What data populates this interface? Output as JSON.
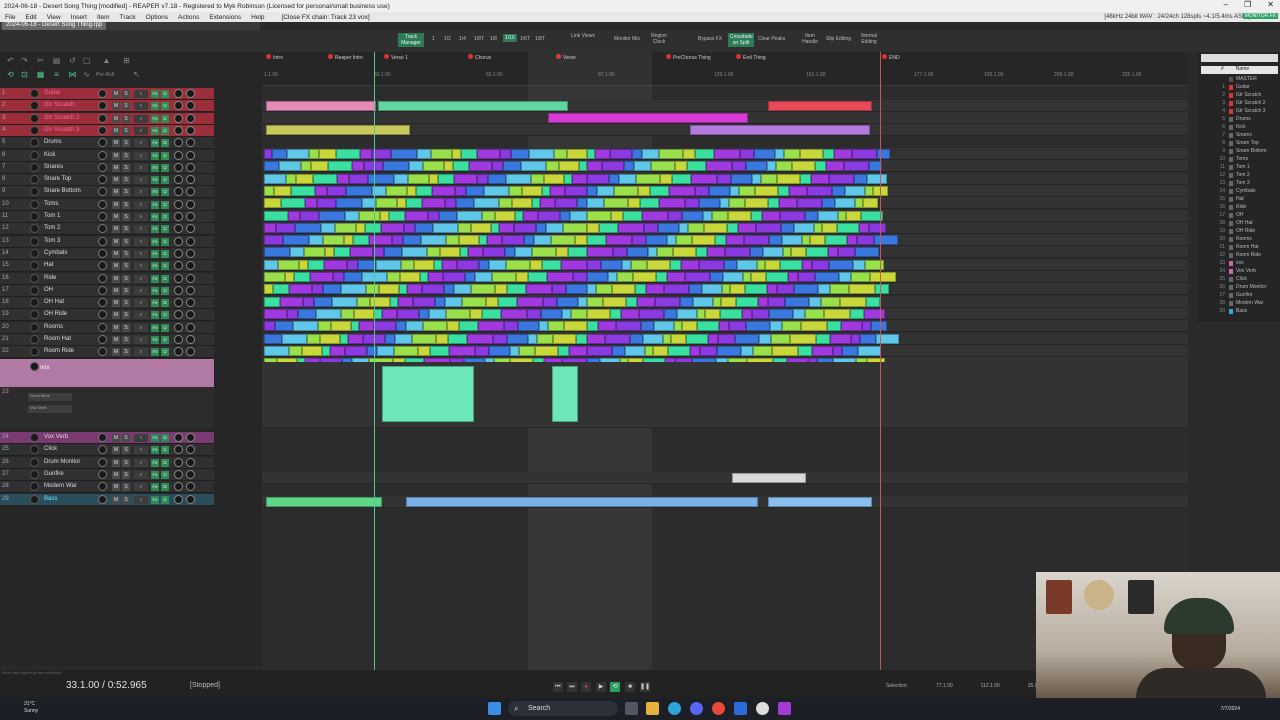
{
  "window": {
    "title": "2024-06-18 - Desert Song Thing [modified] - REAPER v7.18 - Registered to Myk Robinson (Licensed for personal/small business use)",
    "controls": [
      "–",
      "❐",
      "✕"
    ]
  },
  "menu": {
    "items": [
      "File",
      "Edit",
      "View",
      "Insert",
      "Item",
      "Track",
      "Options",
      "Actions",
      "Extensions",
      "Help"
    ],
    "fx_chain_label": "[Close FX chain: Track 23 vox]",
    "status_right": "[48kHz 24bit WAV : 24/24ch 128spls ~4.1/5.4ms ASIO]",
    "mode_indicator": "MONITOR FX"
  },
  "project_tab": "2024-06-18 - Desert Song Thing.rpp",
  "toolbar": {
    "track_manager": "Track Manager",
    "grid_options": [
      "1",
      "1/2",
      "1/4",
      "1/8T",
      "1/8",
      "1/16",
      "1/6T",
      "1/8T"
    ],
    "active_grid": "1/16",
    "buttons": [
      "Link Views",
      "Monitor Mix",
      "Region Clock",
      "Bypass FX",
      "Crossfade on Split",
      "Clear Peaks",
      "Item Handle",
      "Slip Editing",
      "Normal Editing"
    ],
    "preroll_label": "Pre-Roll"
  },
  "tracks": [
    {
      "num": "1",
      "name": "Guitar",
      "color": "red"
    },
    {
      "num": "2",
      "name": "Gtr Scratch",
      "color": "red"
    },
    {
      "num": "3",
      "name": "Gtr Scratch 2",
      "color": "red"
    },
    {
      "num": "4",
      "name": "Gtr Scratch 3",
      "color": "red"
    },
    {
      "num": "5",
      "name": "Drums",
      "color": ""
    },
    {
      "num": "6",
      "name": "Kick",
      "color": ""
    },
    {
      "num": "7",
      "name": "Snares",
      "color": ""
    },
    {
      "num": "8",
      "name": "Snare Top",
      "color": ""
    },
    {
      "num": "9",
      "name": "Snare Bottom",
      "color": ""
    },
    {
      "num": "10",
      "name": "Toms",
      "color": ""
    },
    {
      "num": "11",
      "name": "Tom 1",
      "color": ""
    },
    {
      "num": "12",
      "name": "Tom 2",
      "color": ""
    },
    {
      "num": "13",
      "name": "Tom 3",
      "color": ""
    },
    {
      "num": "14",
      "name": "Cymbals",
      "color": ""
    },
    {
      "num": "15",
      "name": "Hat",
      "color": ""
    },
    {
      "num": "16",
      "name": "Ride",
      "color": ""
    },
    {
      "num": "17",
      "name": "OH",
      "color": ""
    },
    {
      "num": "18",
      "name": "OH Hat",
      "color": ""
    },
    {
      "num": "19",
      "name": "OH Ride",
      "color": ""
    },
    {
      "num": "20",
      "name": "Rooms",
      "color": ""
    },
    {
      "num": "21",
      "name": "Room Hat",
      "color": ""
    },
    {
      "num": "22",
      "name": "Room Ride",
      "color": ""
    }
  ],
  "vox": {
    "num": "23",
    "name": "vox",
    "sends": [
      "Drum Moni",
      "Vox Verb"
    ]
  },
  "tracks_lower": [
    {
      "num": "24",
      "name": "Vox Verb",
      "color": "pink"
    },
    {
      "num": "25",
      "name": "Click",
      "color": ""
    },
    {
      "num": "26",
      "name": "Drum Monitor",
      "color": ""
    },
    {
      "num": "27",
      "name": "Gunfire",
      "color": ""
    },
    {
      "num": "28",
      "name": "Modern War",
      "color": ""
    },
    {
      "num": "29",
      "name": "Bass",
      "color": "teal"
    }
  ],
  "markers": [
    "Intro",
    "Reaper Intro",
    "Verse 1",
    "Chorus",
    "Verse",
    "PreChorus Thing",
    "End Thing",
    "END"
  ],
  "ruler_ticks": [
    "1.1.00",
    "33.1.00",
    "65.1.00",
    "97.1.00",
    "129.1.00",
    "161.1.00",
    "177.1.00",
    "193.1.00",
    "209.1.00",
    "225.1.00"
  ],
  "track_list": {
    "header": [
      "#",
      "Name"
    ],
    "items": [
      {
        "num": "",
        "name": "MASTER"
      },
      {
        "num": "1",
        "name": "Guitar"
      },
      {
        "num": "2",
        "name": "Gtr Scratch"
      },
      {
        "num": "3",
        "name": "Gtr Scratch 2"
      },
      {
        "num": "4",
        "name": "Gtr Scratch 3"
      },
      {
        "num": "5",
        "name": "Drums"
      },
      {
        "num": "6",
        "name": "Kick"
      },
      {
        "num": "7",
        "name": "Snares"
      },
      {
        "num": "8",
        "name": "Snare Top"
      },
      {
        "num": "9",
        "name": "Snare Bottom"
      },
      {
        "num": "10",
        "name": "Toms"
      },
      {
        "num": "11",
        "name": "Tom 1"
      },
      {
        "num": "12",
        "name": "Tom 2"
      },
      {
        "num": "13",
        "name": "Tom 3"
      },
      {
        "num": "14",
        "name": "Cymbals"
      },
      {
        "num": "15",
        "name": "Hat"
      },
      {
        "num": "16",
        "name": "Ride"
      },
      {
        "num": "17",
        "name": "OH"
      },
      {
        "num": "18",
        "name": "OH Hat"
      },
      {
        "num": "19",
        "name": "OH Ride"
      },
      {
        "num": "20",
        "name": "Rooms"
      },
      {
        "num": "21",
        "name": "Room Hat"
      },
      {
        "num": "22",
        "name": "Room Ride"
      },
      {
        "num": "23",
        "name": "vox"
      },
      {
        "num": "24",
        "name": "Vox Verb"
      },
      {
        "num": "25",
        "name": "Click"
      },
      {
        "num": "26",
        "name": "Drum Monitor"
      },
      {
        "num": "27",
        "name": "Gunfire"
      },
      {
        "num": "28",
        "name": "Modern War"
      },
      {
        "num": "29",
        "name": "Bass"
      }
    ]
  },
  "transport": {
    "position": "33.1.00 / 0:52.965",
    "state": "[Stopped]",
    "hint": "Move item ignoring time selection",
    "selection_label": "Selection:",
    "selection_start": "77.1.00",
    "selection_end": "112.1.00",
    "selection_len": "35.0"
  },
  "taskbar": {
    "temp": "31°C",
    "weather": "Sunny",
    "search": "Search",
    "date": "7/7/2024"
  }
}
